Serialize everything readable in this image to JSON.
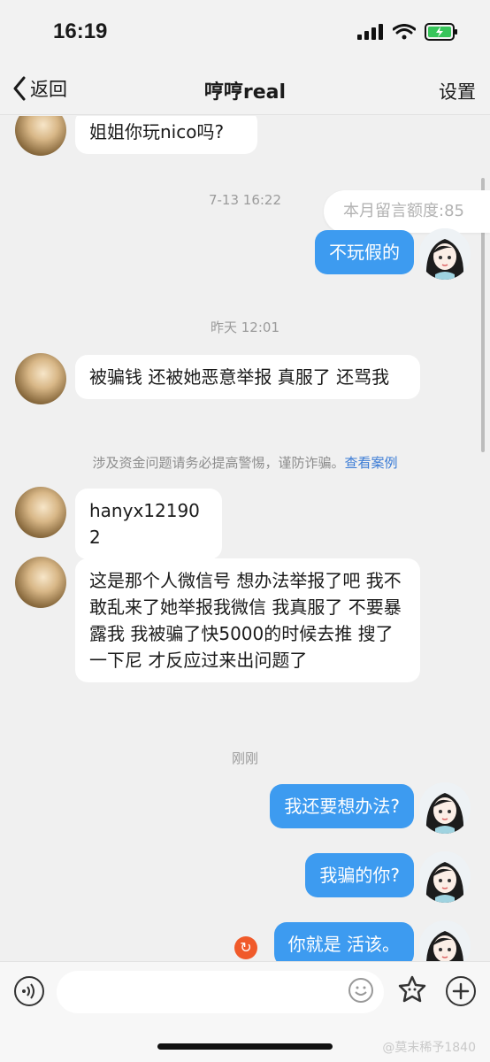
{
  "status_bar": {
    "time": "16:19"
  },
  "nav": {
    "back_label": "返回",
    "title": "哼哼real",
    "settings_label": "设置"
  },
  "quota": "本月留言额度:85",
  "messages": [
    {
      "side": "left",
      "text": "姐姐你玩nico吗?"
    },
    {
      "timestamp": "7-13 16:22"
    },
    {
      "side": "right",
      "text": "不玩假的"
    },
    {
      "timestamp": "昨天 12:01"
    },
    {
      "side": "left",
      "text": "被骗钱 还被她恶意举报 真服了 还骂我"
    },
    {
      "notice": "涉及资金问题请务必提高警惕，谨防诈骗。",
      "notice_link": "查看案例"
    },
    {
      "side": "left",
      "text": "hanyx121902"
    },
    {
      "side": "left",
      "text": "这是那个人微信号 想办法举报了吧 我不敢乱来了她举报我微信 我真服了 不要暴露我 我被骗了快5000的时候去推 搜了一下尼 才反应过来出问题了"
    },
    {
      "timestamp": "刚刚"
    },
    {
      "side": "right",
      "text": "我还要想办法?"
    },
    {
      "side": "right",
      "text": "我骗的你?"
    },
    {
      "side": "right",
      "text": "你就是 活该。",
      "failed": true
    }
  ],
  "watermark": "@莫末稀予1840"
}
